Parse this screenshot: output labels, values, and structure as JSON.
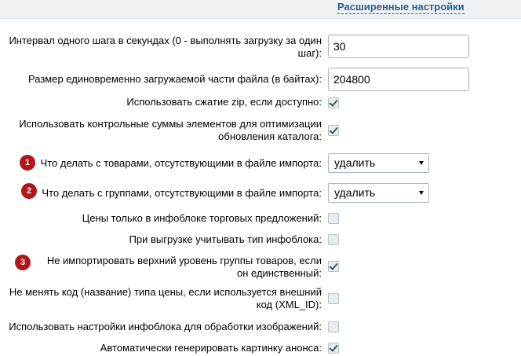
{
  "header": {
    "advanced_link": "Расширенные настройки"
  },
  "fields": {
    "step_interval": {
      "label": "Интервал одного шага в секундах (0 - выполнять загрузку за один шаг):",
      "value": "30"
    },
    "chunk_size": {
      "label": "Размер единовременно загружаемой части файла (в байтах):",
      "value": "204800"
    },
    "use_zip": {
      "label": "Использовать сжатие zip, если доступно:",
      "checked": true
    },
    "use_checksums": {
      "label": "Использовать контрольные суммы элементов для оптимизации обновления каталога:",
      "checked": true
    },
    "missing_products": {
      "badge": "1",
      "label": "Что делать с товарами, отсутствующими в файле импорта:",
      "value": "удалить"
    },
    "missing_groups": {
      "badge": "2",
      "label": "Что делать с группами, отсутствующими в файле импорта:",
      "value": "удалить"
    },
    "prices_offers_only": {
      "label": "Цены только в инфоблоке торговых предложений:",
      "checked": false
    },
    "consider_iblock_type": {
      "label": "При выгрузке учитывать тип инфоблока:",
      "checked": false
    },
    "skip_top_group": {
      "badge": "3",
      "label": "Не импортировать верхний уровень группы товаров, если он единственный:",
      "checked": true
    },
    "keep_price_code": {
      "label": "Не менять код (название) типа цены, если используется внешний код (XML_ID):",
      "checked": false
    },
    "iblock_image_settings": {
      "label": "Использовать настройки инфоблока для обработки изображений:",
      "checked": false
    },
    "auto_preview": {
      "label": "Автоматически генерировать картинку анонса:",
      "checked": true
    }
  }
}
